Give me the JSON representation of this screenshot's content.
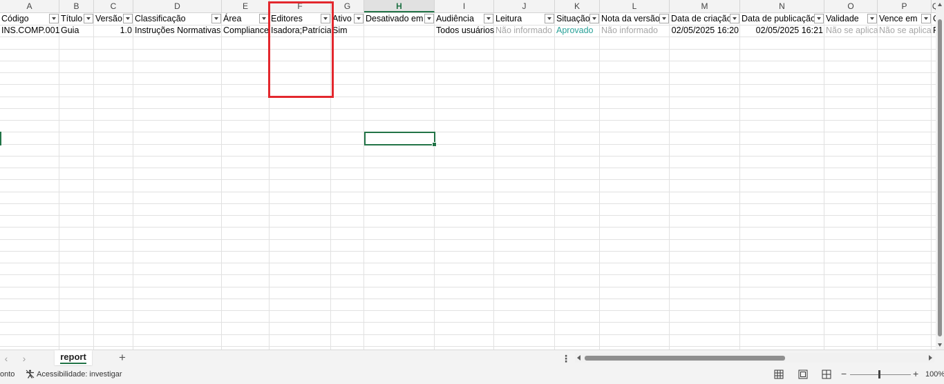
{
  "columns": [
    "A",
    "B",
    "C",
    "D",
    "E",
    "F",
    "G",
    "H",
    "I",
    "J",
    "K",
    "L",
    "M",
    "N",
    "O",
    "P",
    "Q"
  ],
  "header_row": [
    "Código",
    "Título",
    "Versão",
    "Classificação",
    "Área",
    "Editores",
    "Ativo",
    "Desativado em",
    "Audiência",
    "Leitura",
    "Situação",
    "Nota da versão",
    "Data de criação",
    "Data de publicação",
    "Validade",
    "Vence em",
    "C"
  ],
  "data_row": [
    "INS.COMP.001",
    "Guia",
    "1.0",
    "Instruções Normativas",
    "Compliance",
    "Isadora;Patrícia",
    "Sim",
    "",
    "Todos usuários",
    "Não informado",
    "Aprovado",
    "Não informado",
    "02/05/2025 16:20",
    "02/05/2025 16:21",
    "Não se aplica",
    "Não se aplica",
    "R"
  ],
  "selected_column": "H",
  "colors": {
    "accent_green": "#217346",
    "highlight_red": "#e3272d",
    "status_green": "#2aa198",
    "muted_gray": "#a6a6a6"
  },
  "sheet_tabs": {
    "active": "report",
    "add_label": "+",
    "prev_icon": "chevron-left-icon",
    "next_icon": "chevron-right-icon",
    "menu_label": "⋮"
  },
  "status_bar": {
    "mode_text": "onto",
    "accessibility_text": "Acessibilidade: investigar",
    "zoom_minus": "−",
    "zoom_plus": "+",
    "zoom": "100%"
  }
}
